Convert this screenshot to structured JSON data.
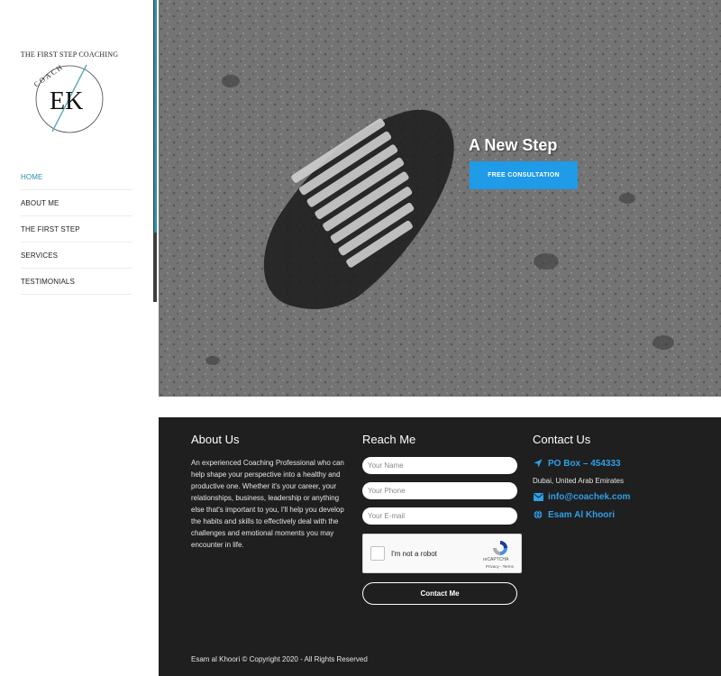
{
  "brand": {
    "tagline": "THE FIRST STEP COACHING",
    "logo_arc_text": "COACH",
    "logo_initials": "EK"
  },
  "nav": {
    "items": [
      {
        "label": "HOME",
        "active": true
      },
      {
        "label": "ABOUT ME",
        "active": false
      },
      {
        "label": "THE FIRST STEP",
        "active": false
      },
      {
        "label": "SERVICES",
        "active": false
      },
      {
        "label": "TESTIMONIALS",
        "active": false
      }
    ]
  },
  "hero": {
    "title": "A New Step",
    "cta_label": "FREE CONSULTATION"
  },
  "footer": {
    "about": {
      "title": "About Us",
      "text": "An experienced Coaching Professional who can help shape your perspective into a healthy and productive one. Whether it's your career, your relationships, business, leadership or anything else that's important to you, I'll help you develop the habits and skills to effectively deal with the challenges and emotional moments you may encounter in life."
    },
    "reach": {
      "title": "Reach Me",
      "name_placeholder": "Your Name",
      "phone_placeholder": "Your Phone",
      "email_placeholder": "Your E-mail",
      "captcha_label": "I'm not a robot",
      "captcha_brand": "reCAPTCHA",
      "captcha_links": "Privacy - Terms",
      "submit_label": "Contact Me"
    },
    "contact": {
      "title": "Contact Us",
      "po_box": "PO Box – 454333",
      "city": "Dubai, United Arab Emirates",
      "email": "info@coachek.com",
      "name": "Esam Al Khoori"
    },
    "copyright": "Esam al Khoori  © Copyright 2020 - All Rights Reserved"
  },
  "colors": {
    "accent": "#2b8fa6",
    "cta": "#1f9be8",
    "link": "#2f9fe6",
    "footer_bg": "#1f1f1f"
  },
  "icons": {
    "po_box": "location-arrow-icon",
    "email": "envelope-icon",
    "name": "globe-icon",
    "captcha": "recaptcha-icon"
  }
}
